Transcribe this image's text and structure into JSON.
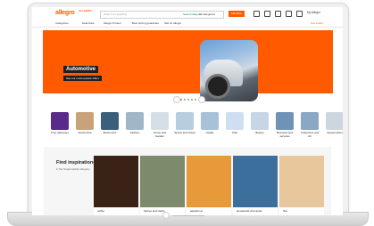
{
  "header": {
    "logo": "allegro",
    "logo_sub": "ALLEGRO",
    "search_placeholder": "Search for anything",
    "search_location": "Search Allegro",
    "search_category": "All categories",
    "search_button": "SEARCH",
    "account": "My Allegro"
  },
  "nav": {
    "items": [
      "Categories",
      "Deal Zone",
      "Allegro Protect",
      "Best pricing guarantee",
      "Sell on Allegro"
    ],
    "right": "Get smart!"
  },
  "banner": {
    "title": "Automotive",
    "subtitle": "See our most popular offers"
  },
  "categories": [
    {
      "label": "Free deliveries",
      "color": "#5a2a8a"
    },
    {
      "label": "Automotive",
      "color": "#caa27a"
    },
    {
      "label": "Electronics",
      "color": "#3b5f7a"
    },
    {
      "label": "Fashion",
      "color": "#9fb7c9"
    },
    {
      "label": "Home and Garden",
      "color": "#d7dfe6"
    },
    {
      "label": "Sports and Travel",
      "color": "#b7cde0"
    },
    {
      "label": "Health",
      "color": "#a7c1d8"
    },
    {
      "label": "Kids",
      "color": "#cfdff0"
    },
    {
      "label": "Beauty",
      "color": "#c7d6e4"
    },
    {
      "label": "Business and services",
      "color": "#6f93b8"
    },
    {
      "label": "Collections and Art",
      "color": "#8aa7c4"
    },
    {
      "label": "Supermarket",
      "color": "#cbd6df"
    }
  ],
  "inspirations": {
    "title": "Find inspirations",
    "subtitle": "in the Supermarket category",
    "cards": [
      {
        "label": "coffee",
        "color": "#3a2316"
      },
      {
        "label": "Spices and Herbs",
        "color": "#7d8a6b"
      },
      {
        "label": "aquariums",
        "color": "#e89a3a"
      },
      {
        "label": "Household chemicals",
        "color": "#3d6f9c"
      },
      {
        "label": "Tea",
        "color": "#e7c79b"
      }
    ]
  },
  "colors": {
    "accent": "#ff5a00"
  }
}
